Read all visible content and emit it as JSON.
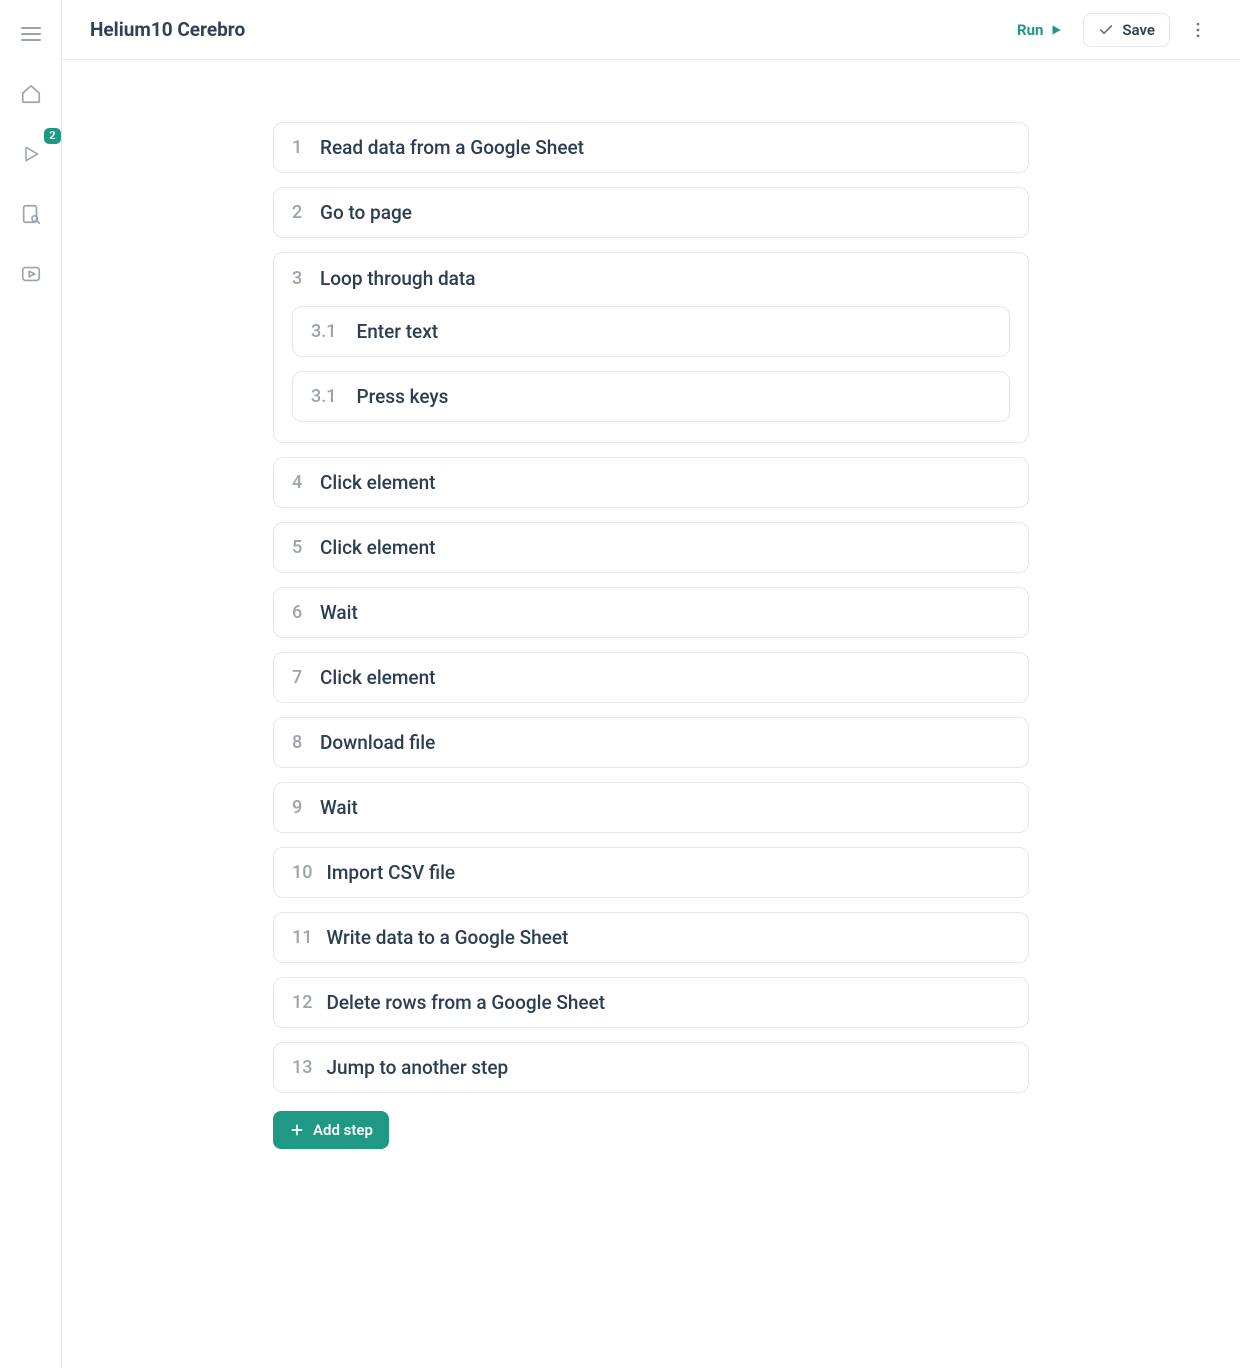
{
  "header": {
    "title": "Helium10 Cerebro",
    "run_label": "Run",
    "save_label": "Save"
  },
  "sidebar": {
    "badge_count": "2"
  },
  "steps": [
    {
      "num": "1",
      "label": "Read data from a Google Sheet"
    },
    {
      "num": "2",
      "label": "Go to page"
    },
    {
      "num": "3",
      "label": "Loop through data",
      "children": [
        {
          "num": "3.1",
          "label": "Enter text"
        },
        {
          "num": "3.1",
          "label": "Press keys"
        }
      ]
    },
    {
      "num": "4",
      "label": "Click element"
    },
    {
      "num": "5",
      "label": "Click element"
    },
    {
      "num": "6",
      "label": "Wait"
    },
    {
      "num": "7",
      "label": "Click element"
    },
    {
      "num": "8",
      "label": "Download file"
    },
    {
      "num": "9",
      "label": "Wait"
    },
    {
      "num": "10",
      "label": "Import CSV file"
    },
    {
      "num": "11",
      "label": "Write data to a Google Sheet"
    },
    {
      "num": "12",
      "label": "Delete rows from a Google Sheet"
    },
    {
      "num": "13",
      "label": "Jump to another step"
    }
  ],
  "add_step_label": "Add step"
}
